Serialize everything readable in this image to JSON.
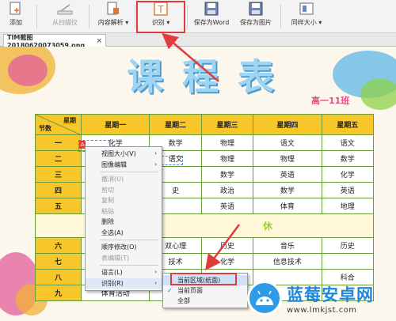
{
  "toolbar": {
    "add": "添加",
    "scan": "从扫描仪",
    "parse": "内容解析",
    "recognize": "识别",
    "save_word": "保存为Word",
    "save_image": "保存为图片",
    "same_size": "同样大小"
  },
  "tab": {
    "filename": "TIM截图20180620073059.png",
    "close": "×"
  },
  "document": {
    "title": "课程表",
    "class_label": "高一11班",
    "header": {
      "corner_top": "星期",
      "corner_bottom": "节数",
      "days": [
        "星期一",
        "星期二",
        "星期三",
        "星期四",
        "星期五"
      ]
    },
    "rows": [
      {
        "period": "一",
        "cells": [
          "化学",
          "数学",
          "物理",
          "语文",
          "语文"
        ]
      },
      {
        "period": "二",
        "cells": [
          "",
          "语文",
          "物理",
          "物理",
          "数学"
        ]
      },
      {
        "period": "三",
        "cells": [
          "",
          "",
          "数学",
          "英语",
          "化学"
        ]
      },
      {
        "period": "四",
        "cells": [
          "",
          "史",
          "政治",
          "数学",
          "英语"
        ]
      },
      {
        "period": "五",
        "cells": [
          "",
          "",
          "英语",
          "体育",
          "地理"
        ]
      }
    ],
    "noon": "休",
    "rows_pm": [
      {
        "period": "六",
        "cells": [
          "",
          "双心理",
          "历史",
          "音乐",
          "历史"
        ]
      },
      {
        "period": "七",
        "cells": [
          "",
          "技术",
          "化学",
          "信息技术",
          ""
        ]
      },
      {
        "period": "八",
        "cells": [
          "",
          "",
          "",
          "",
          "科合"
        ]
      },
      {
        "period": "九",
        "cells": [
          "体育活动",
          "",
          "",
          "",
          ""
        ]
      }
    ]
  },
  "context_menu": {
    "items": [
      {
        "label": "视图大小(V)",
        "sub": true,
        "disabled": false
      },
      {
        "label": "图像编辑",
        "sub": true,
        "disabled": false
      },
      {
        "sep": true
      },
      {
        "label": "撤消(U)",
        "disabled": true
      },
      {
        "label": "剪切",
        "disabled": true
      },
      {
        "label": "复制",
        "disabled": true
      },
      {
        "label": "粘贴",
        "disabled": true
      },
      {
        "label": "删除",
        "disabled": false
      },
      {
        "label": "全选(A)",
        "disabled": false
      },
      {
        "sep": true
      },
      {
        "label": "顺序修改(O)",
        "disabled": false
      },
      {
        "label": "表编辑(T)",
        "disabled": true
      },
      {
        "sep": true
      },
      {
        "label": "语言(L)",
        "sub": true,
        "disabled": false
      },
      {
        "label": "识别(R)",
        "sub": true,
        "disabled": false,
        "active": true
      }
    ],
    "submenu": [
      {
        "label": "当前区域(纸面)",
        "checked": false,
        "highlight": true
      },
      {
        "label": "当前页面",
        "checked": true,
        "highlight": false
      },
      {
        "label": "全部",
        "checked": false,
        "highlight": false
      }
    ]
  },
  "watermark": {
    "name": "蓝莓安卓网",
    "url": "www.lmkjst.com"
  },
  "colors": {
    "highlight": "#e23b3b",
    "table_header": "#f7c72a",
    "title": "#9fd4f2",
    "watermark_blue": "#1f86d8"
  }
}
